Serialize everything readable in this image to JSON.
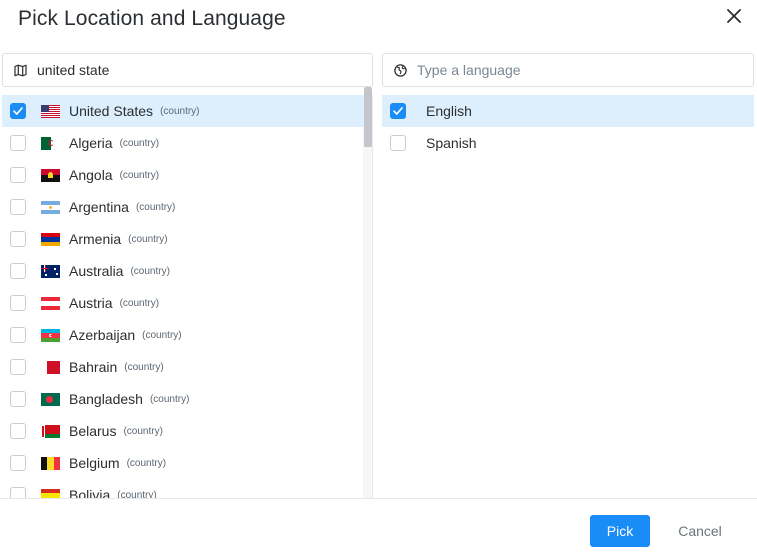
{
  "dialog": {
    "title": "Pick Location and Language"
  },
  "location_search": {
    "value": "united state",
    "icon": "map-icon"
  },
  "language_search": {
    "placeholder": "Type a language",
    "icon": "globe-icon"
  },
  "locations": [
    {
      "name": "United States",
      "type": "(country)",
      "checked": true,
      "flag": "us"
    },
    {
      "name": "Algeria",
      "type": "(country)",
      "checked": false,
      "flag": "dz"
    },
    {
      "name": "Angola",
      "type": "(country)",
      "checked": false,
      "flag": "ao"
    },
    {
      "name": "Argentina",
      "type": "(country)",
      "checked": false,
      "flag": "ar"
    },
    {
      "name": "Armenia",
      "type": "(country)",
      "checked": false,
      "flag": "am"
    },
    {
      "name": "Australia",
      "type": "(country)",
      "checked": false,
      "flag": "au"
    },
    {
      "name": "Austria",
      "type": "(country)",
      "checked": false,
      "flag": "at"
    },
    {
      "name": "Azerbaijan",
      "type": "(country)",
      "checked": false,
      "flag": "az"
    },
    {
      "name": "Bahrain",
      "type": "(country)",
      "checked": false,
      "flag": "bh"
    },
    {
      "name": "Bangladesh",
      "type": "(country)",
      "checked": false,
      "flag": "bd"
    },
    {
      "name": "Belarus",
      "type": "(country)",
      "checked": false,
      "flag": "by"
    },
    {
      "name": "Belgium",
      "type": "(country)",
      "checked": false,
      "flag": "be"
    },
    {
      "name": "Bolivia",
      "type": "(country)",
      "checked": false,
      "flag": "bo"
    }
  ],
  "languages": [
    {
      "name": "English",
      "checked": true
    },
    {
      "name": "Spanish",
      "checked": false
    }
  ],
  "footer": {
    "pick_label": "Pick",
    "cancel_label": "Cancel"
  },
  "colors": {
    "accent": "#1a8cf5",
    "selected_row": "#ddeefc"
  }
}
